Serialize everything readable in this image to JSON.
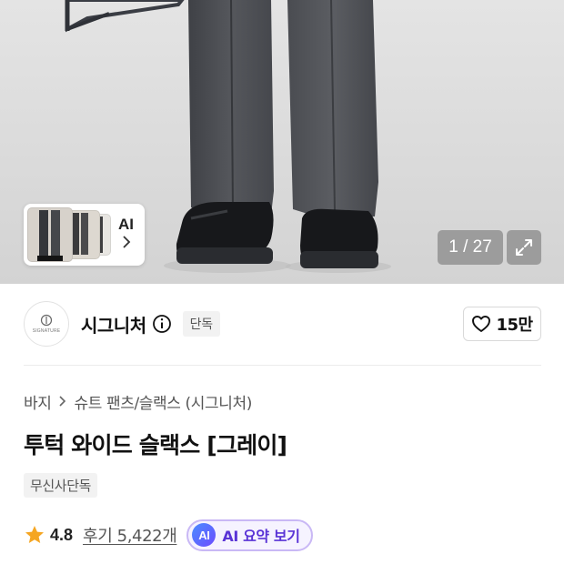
{
  "gallery": {
    "thumb_label": "AI",
    "counter": "1 / 27"
  },
  "brand": {
    "name": "시그니처",
    "logo_text": "SIGNATURE",
    "badge": "단독",
    "like_count": "15만"
  },
  "breadcrumb": {
    "items": [
      "바지",
      "슈트 팬츠/슬랙스 (시그니처)"
    ]
  },
  "product": {
    "title": "투턱 와이드 슬랙스 [그레이]",
    "store_tag": "무신사단독",
    "rating": "4.8",
    "review_text": "후기 5,422개",
    "ai_badge": "AI",
    "ai_summary_label": "AI 요약 보기"
  },
  "colors": {
    "star": "#F5A623",
    "ai_accent": "#5A34D6"
  },
  "icons": {
    "info": "info-icon",
    "heart": "heart-outline-icon",
    "expand": "expand-icon",
    "star": "star-icon",
    "chevron": "chevron-right-icon"
  }
}
